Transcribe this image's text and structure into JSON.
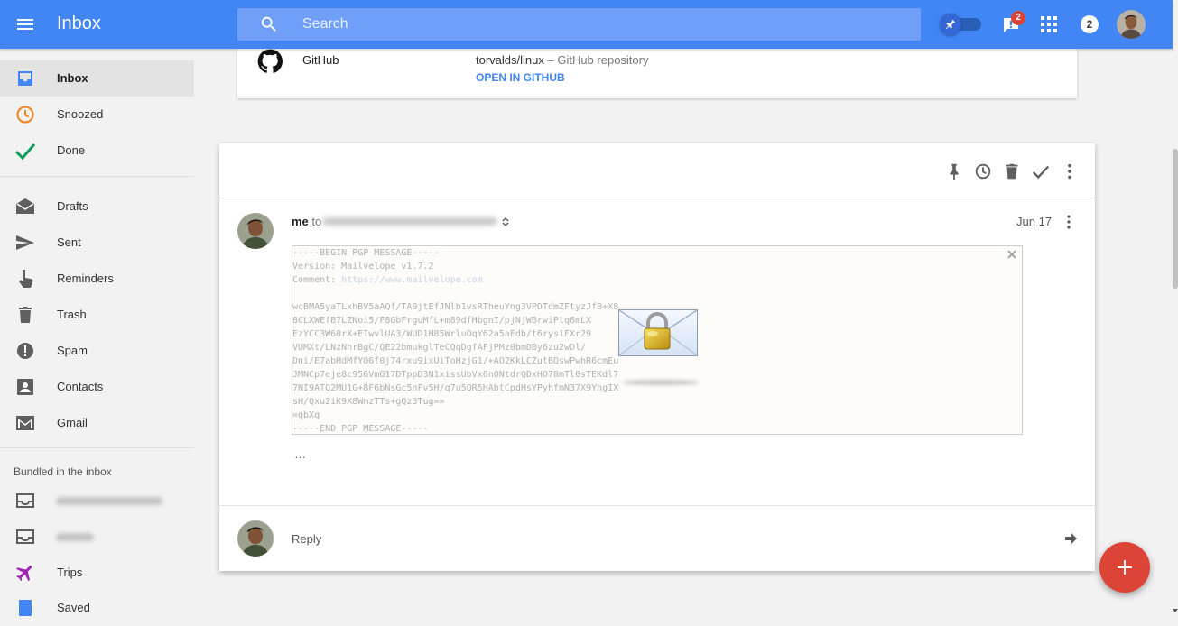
{
  "header": {
    "title": "Inbox",
    "search_placeholder": "Search",
    "reminder_badge": "2",
    "notification_count": "2"
  },
  "sidebar": {
    "items": [
      {
        "label": "Inbox",
        "icon": "inbox-icon",
        "active": true
      },
      {
        "label": "Snoozed",
        "icon": "clock-icon"
      },
      {
        "label": "Done",
        "icon": "check-icon"
      },
      {
        "label": "Drafts",
        "icon": "drafts-icon"
      },
      {
        "label": "Sent",
        "icon": "send-icon"
      },
      {
        "label": "Reminders",
        "icon": "reminder-hand-icon"
      },
      {
        "label": "Trash",
        "icon": "trash-icon"
      },
      {
        "label": "Spam",
        "icon": "spam-icon"
      },
      {
        "label": "Contacts",
        "icon": "contacts-icon"
      },
      {
        "label": "Gmail",
        "icon": "gmail-icon"
      }
    ],
    "bundled_heading": "Bundled in the inbox",
    "bundles": [
      {
        "label": "Trips",
        "icon": "airplane-icon"
      },
      {
        "label": "Saved",
        "icon": "bookmark-icon"
      }
    ]
  },
  "prev_card": {
    "source": "GitHub",
    "repo": "torvalds/linux",
    "repo_desc": " – GitHub repository",
    "link": "OPEN IN GITHUB"
  },
  "message": {
    "sender": "me",
    "to_label": "to",
    "date": "Jun 17",
    "pgp_lines": [
      "-----BEGIN PGP MESSAGE-----",
      "Version: Mailvelope v1.7.2",
      "Comment: ",
      "",
      "wcBMA5yaTLxhBV5aAQf/TA9jtEfJNlb1vsRTheuYng3VPDTdmZFtyzJfB+X8",
      "8CLXWEfB7LZNoi5/F8GbFrguMfL+m89dfHbgnI/pjNjWBrwiPtq6mLX",
      "EzYCC3W60rX+EIwvlUA3/WUD1H85WrluOqY62a5aEdb/t6rys1FXr29",
      "VUMXt/LNzNhrBgC/QE22bmukglTeCQqDgfAFjPMz0bmDBy6zu2wDl/",
      "Dni/E7abHdMfYO6f0j74rxu9ixUiToHzjG1/+AO2KkLCZutBQswPwhR6cmEu",
      "JMNCp7eje8c956VmG17DTppD3N1xissUbVx6nONtdrQDxHO78mTl0sTEKdl7",
      "7NI9ATQ2MU1G+8F6bNsGc5nFv5H/q7u5QR5HAbtCpdHsYPyhfmN37X9YhgIX",
      "sH/Qxu2iK9X8WmzTTs+gQz3Tug==",
      "=qbXq",
      "-----END PGP MESSAGE-----"
    ],
    "pgp_comment_url": "https://www.mailvelope.com",
    "ellipsis": "…"
  },
  "reply": {
    "label": "Reply"
  }
}
